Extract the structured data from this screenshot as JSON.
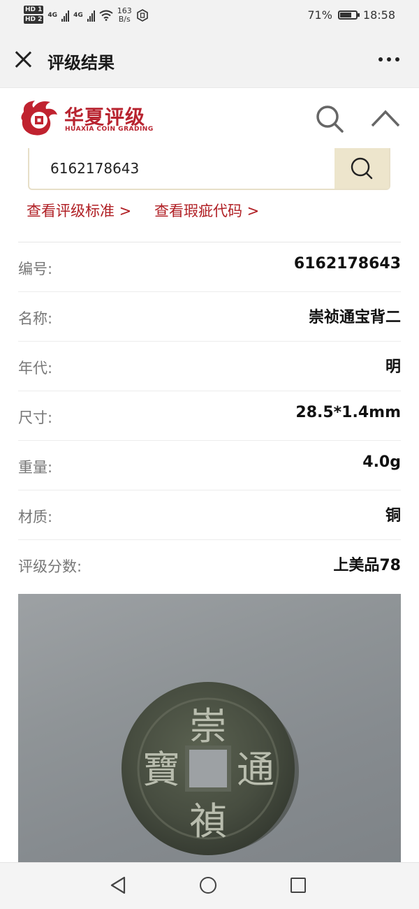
{
  "status_bar": {
    "hd1": "HD 1",
    "hd2": "HD 2",
    "net1": "4G",
    "net2": "4G",
    "speed_value": "163",
    "speed_unit": "B/s",
    "battery": "71%",
    "battery_level": 0.71,
    "time": "18:58"
  },
  "header": {
    "title": "评级结果",
    "close_icon": "close-icon",
    "more_icon": "more-icon"
  },
  "site": {
    "logo_cn": "华夏评级",
    "logo_en": "HUAXIA COIN GRADING",
    "brand_color": "#b8232f"
  },
  "search": {
    "value": "6162178643"
  },
  "links": {
    "grading_standard": "查看评级标准 >",
    "defect_codes": "查看瑕疵代码 >"
  },
  "details": [
    {
      "label": "编号:",
      "value": "6162178643"
    },
    {
      "label": "名称:",
      "value": "崇祯通宝背二"
    },
    {
      "label": "年代:",
      "value": "明"
    },
    {
      "label": "尺寸:",
      "value": "28.5*1.4mm"
    },
    {
      "label": "重量:",
      "value": "4.0g"
    },
    {
      "label": "材质:",
      "value": "铜"
    },
    {
      "label": "评级分数:",
      "value": "上美品78"
    }
  ],
  "coin": {
    "top": "崇",
    "bottom": "禎",
    "left": "寶",
    "right": "通"
  }
}
